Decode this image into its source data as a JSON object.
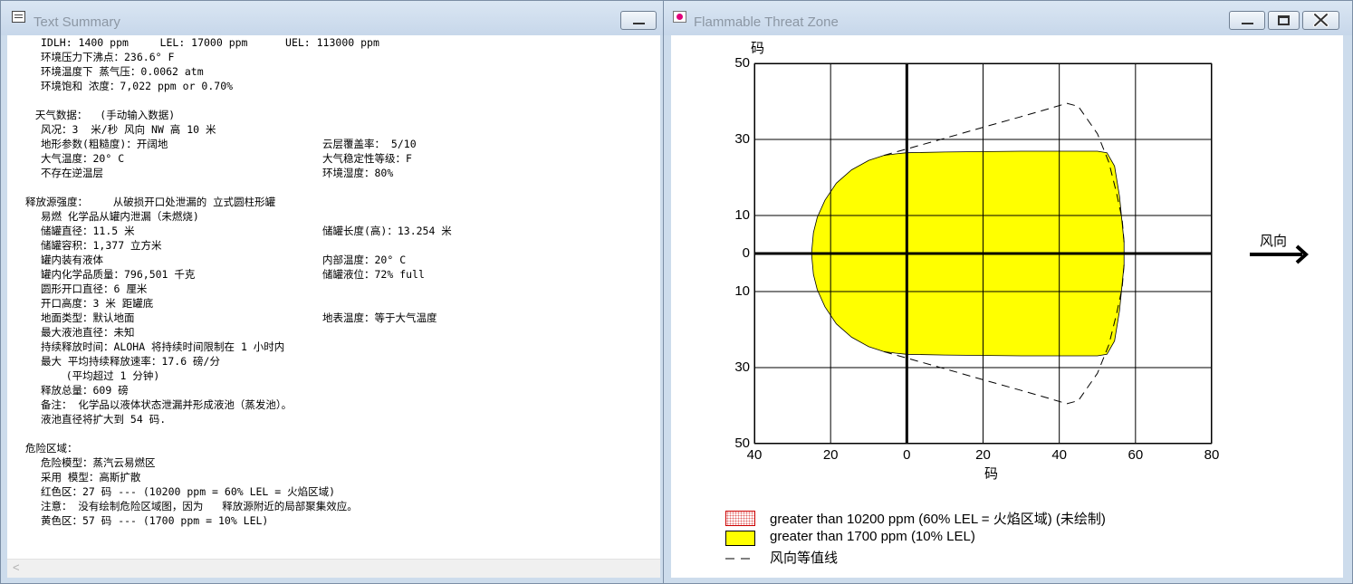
{
  "left_window": {
    "title": "Text Summary",
    "lines": [
      "IDLH: 1400 ppm     LEL: 17000 ppm      UEL: 113000 ppm",
      "环境压力下沸点：236.6° F",
      "环境温度下 蒸气压：0.0062 atm",
      "环境饱和 浓度：7,022 ppm or 0.70%",
      "",
      " 天气数据：  (手动输入数据)",
      "风况：3  米/秒 风向 NW 高 10 米",
      "地形参数(粗糙度)：开阔地",
      "大气温度：20° C",
      "不存在逆温层",
      "",
      "释放源强度：    从破损开口处泄漏的 立式圆柱形罐",
      "易燃 化学品从罐内泄漏（未燃烧)",
      "储罐直径：11.5 米",
      "储罐容积：1,377 立方米",
      "罐内装有液体",
      "罐内化学品质量：796,501 千克",
      "圆形开口直径：6 厘米",
      "开口高度：3 米 距罐底",
      "地面类型：默认地面",
      "最大液池直径：未知",
      "持续释放时间：ALOHA 将持续时间限制在 1 小时内",
      "最大 平均持续释放速率：17.6 磅/分",
      "    (平均超过 1 分钟)",
      "释放总量：609 磅",
      "备注： 化学品以液体状态泄漏并形成液池（蒸发池）。",
      "液池直径将扩大到 54 码.",
      "",
      "危险区域：",
      "危险模型：蒸汽云易燃区",
      "采用 模型：高斯扩散",
      "红色区：27 码 --- (10200 ppm = 60% LEL = 火焰区域)",
      "注意： 没有绘制危险区域图，因为   释放源附近的局部聚集效应。",
      "黄色区：57 码 --- (1700 ppm = 10% LEL)"
    ],
    "right_col": [
      {
        "row": 7,
        "text": "云层覆盖率： 5/10"
      },
      {
        "row": 8,
        "text": "大气稳定性等级：F"
      },
      {
        "row": 9,
        "text": "环境湿度：80%"
      },
      {
        "row": 13,
        "text": "储罐长度(高)：13.254 米"
      },
      {
        "row": 15,
        "text": "内部温度：20° C"
      },
      {
        "row": 16,
        "text": "储罐液位：72% full"
      },
      {
        "row": 19,
        "text": "地表温度：等于大气温度"
      }
    ]
  },
  "right_window": {
    "title": "Flammable Threat Zone",
    "y_unit": "码",
    "x_unit": "码",
    "wind_label": "风向",
    "legend": [
      {
        "label": "greater than 10200 ppm (60% LEL = 火焰区域) (未绘制)",
        "swatch": "dotted-red"
      },
      {
        "label": "greater than 1700 ppm (10% LEL)",
        "swatch": "#ffff00"
      },
      {
        "label": "风向等值线",
        "swatch": "dashed"
      }
    ]
  },
  "chart_data": {
    "type": "area",
    "x_ticks": [
      40,
      20,
      0,
      20,
      40,
      60,
      80
    ],
    "y_ticks": [
      50,
      30,
      10,
      0,
      10,
      30,
      50
    ],
    "xlim": [
      -40,
      80
    ],
    "ylim": [
      -50,
      50
    ],
    "grid": true,
    "fill_color": "#ffff00",
    "series": [
      {
        "name": "greater than 1700 ppm (10% LEL)",
        "style": "filled",
        "x": [
          -25,
          -24.5,
          -23.5,
          -21.5,
          -18.5,
          -14.5,
          -10,
          -6,
          -3,
          0,
          10,
          30,
          50,
          52.5,
          54.5,
          55.8,
          56.5,
          57,
          57,
          56.5,
          55.8,
          54.5,
          52.5,
          50,
          30,
          10,
          0,
          -3,
          -6,
          -10,
          -14.5,
          -18.5,
          -21.5,
          -23.5,
          -24.5,
          -25
        ],
        "y": [
          0,
          5.5,
          9.5,
          14,
          18.5,
          22,
          24.5,
          25.8,
          26.2,
          26.5,
          26.7,
          26.9,
          26.9,
          26.5,
          23,
          15,
          8,
          3,
          -3,
          -8,
          -15,
          -23,
          -26.5,
          -26.9,
          -26.9,
          -26.7,
          -26.5,
          -26.2,
          -25.8,
          -24.5,
          -22,
          -18.5,
          -14,
          -9.5,
          -5.5,
          0
        ]
      },
      {
        "name": "风向等值线",
        "style": "dashed",
        "x": [
          -6,
          0,
          10,
          20,
          30,
          37,
          42,
          45,
          50,
          53,
          55,
          56.5,
          57
        ],
        "y": [
          25.8,
          27.5,
          30.3,
          33.2,
          36,
          38,
          39.5,
          38.7,
          31.5,
          24,
          16,
          9,
          3
        ]
      },
      {
        "name": "风向等值线",
        "style": "dashed",
        "x": [
          -6,
          0,
          10,
          20,
          30,
          37,
          42,
          45,
          50,
          53,
          55,
          56.5,
          57
        ],
        "y": [
          -25.8,
          -27.5,
          -30.3,
          -33.2,
          -36,
          -38,
          -39.5,
          -38.7,
          -31.5,
          -24,
          -16,
          -9,
          -3
        ]
      }
    ]
  }
}
